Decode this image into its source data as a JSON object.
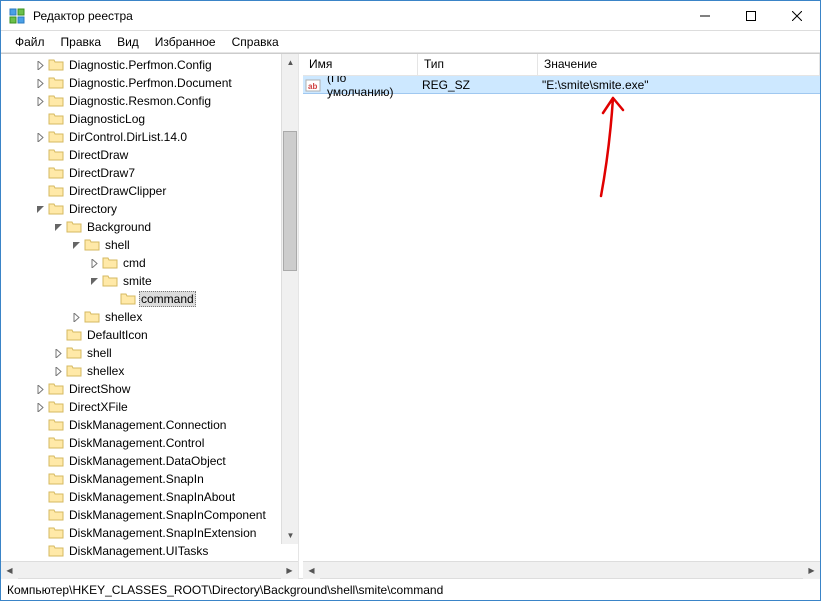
{
  "window": {
    "title": "Редактор реестра"
  },
  "menu": {
    "file": "Файл",
    "edit": "Правка",
    "view": "Вид",
    "favorites": "Избранное",
    "help": "Справка"
  },
  "tree": {
    "items": [
      {
        "depth": 1,
        "exp": "closed",
        "label": "Diagnostic.Perfmon.Config"
      },
      {
        "depth": 1,
        "exp": "closed",
        "label": "Diagnostic.Perfmon.Document"
      },
      {
        "depth": 1,
        "exp": "closed",
        "label": "Diagnostic.Resmon.Config"
      },
      {
        "depth": 1,
        "exp": "none",
        "label": "DiagnosticLog"
      },
      {
        "depth": 1,
        "exp": "closed",
        "label": "DirControl.DirList.14.0"
      },
      {
        "depth": 1,
        "exp": "none",
        "label": "DirectDraw"
      },
      {
        "depth": 1,
        "exp": "none",
        "label": "DirectDraw7"
      },
      {
        "depth": 1,
        "exp": "none",
        "label": "DirectDrawClipper"
      },
      {
        "depth": 1,
        "exp": "open",
        "label": "Directory"
      },
      {
        "depth": 2,
        "exp": "open",
        "label": "Background"
      },
      {
        "depth": 3,
        "exp": "open",
        "label": "shell"
      },
      {
        "depth": 4,
        "exp": "closed",
        "label": "cmd"
      },
      {
        "depth": 4,
        "exp": "open",
        "label": "smite"
      },
      {
        "depth": 5,
        "exp": "none",
        "label": "command",
        "selected": true
      },
      {
        "depth": 3,
        "exp": "closed",
        "label": "shellex"
      },
      {
        "depth": 2,
        "exp": "none",
        "label": "DefaultIcon"
      },
      {
        "depth": 2,
        "exp": "closed",
        "label": "shell"
      },
      {
        "depth": 2,
        "exp": "closed",
        "label": "shellex"
      },
      {
        "depth": 1,
        "exp": "closed",
        "label": "DirectShow"
      },
      {
        "depth": 1,
        "exp": "closed",
        "label": "DirectXFile"
      },
      {
        "depth": 1,
        "exp": "none",
        "label": "DiskManagement.Connection"
      },
      {
        "depth": 1,
        "exp": "none",
        "label": "DiskManagement.Control"
      },
      {
        "depth": 1,
        "exp": "none",
        "label": "DiskManagement.DataObject"
      },
      {
        "depth": 1,
        "exp": "none",
        "label": "DiskManagement.SnapIn"
      },
      {
        "depth": 1,
        "exp": "none",
        "label": "DiskManagement.SnapInAbout"
      },
      {
        "depth": 1,
        "exp": "none",
        "label": "DiskManagement.SnapInComponent"
      },
      {
        "depth": 1,
        "exp": "none",
        "label": "DiskManagement.SnapInExtension"
      },
      {
        "depth": 1,
        "exp": "none",
        "label": "DiskManagement.UITasks"
      }
    ]
  },
  "list": {
    "columns": {
      "name": "Имя",
      "type": "Тип",
      "value": "Значение"
    },
    "rows": [
      {
        "name": "(По умолчанию)",
        "type": "REG_SZ",
        "value": "\"E:\\smite\\smite.exe\""
      }
    ]
  },
  "statusbar": {
    "path": "Компьютер\\HKEY_CLASSES_ROOT\\Directory\\Background\\shell\\smite\\command"
  }
}
